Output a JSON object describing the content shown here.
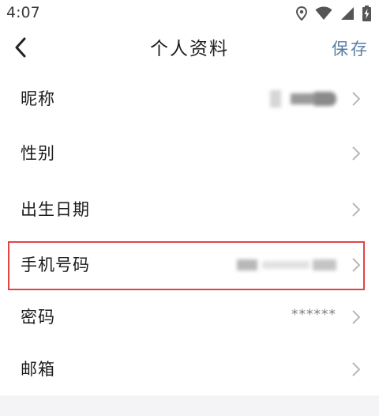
{
  "status_bar": {
    "time": "4:07",
    "icons": [
      "location-icon",
      "wifi-icon",
      "signal-icon",
      "battery-charging-icon"
    ]
  },
  "nav": {
    "back_icon": "chevron-left-icon",
    "title": "个人资料",
    "save_label": "保存"
  },
  "profile_rows": [
    {
      "key": "nickname",
      "label": "昵称",
      "value": ""
    },
    {
      "key": "gender",
      "label": "性别",
      "value": ""
    },
    {
      "key": "birthday",
      "label": "出生日期",
      "value": ""
    },
    {
      "key": "phone",
      "label": "手机号码",
      "value": ""
    },
    {
      "key": "password",
      "label": "密码",
      "value": "******"
    },
    {
      "key": "email",
      "label": "邮箱",
      "value": ""
    }
  ],
  "colors": {
    "accent": "#5a7ea4",
    "highlight_border": "#e24444",
    "text_primary": "#1c1c1c",
    "text_secondary": "#7a7a7a",
    "background": "#f4f4f6"
  }
}
